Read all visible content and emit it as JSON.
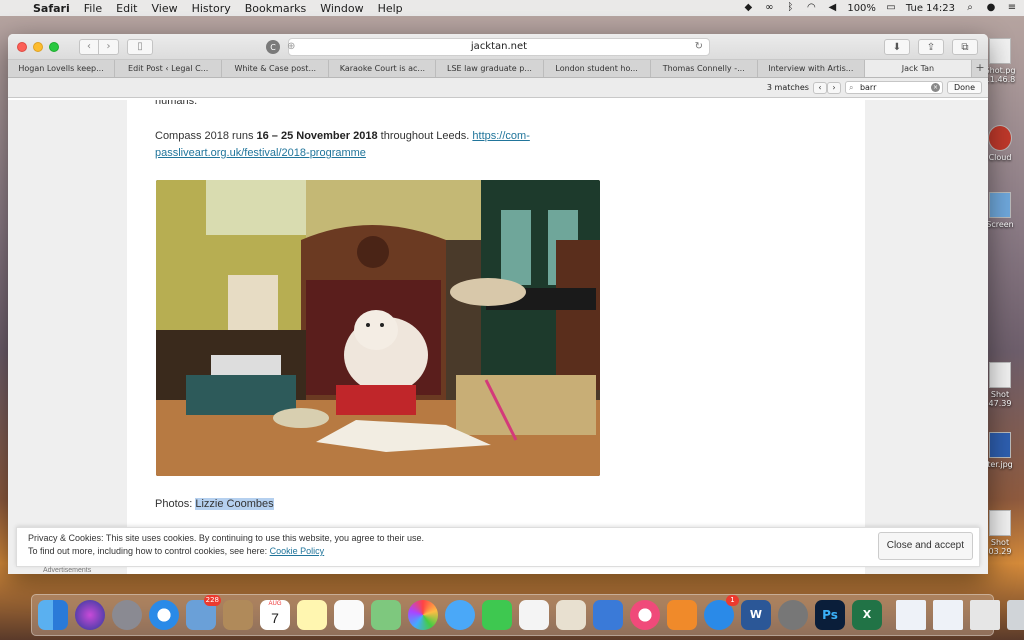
{
  "menubar": {
    "app": "Safari",
    "menus": [
      "File",
      "Edit",
      "View",
      "History",
      "Bookmarks",
      "Window",
      "Help"
    ],
    "battery": "100%",
    "clock": "Tue 14:23"
  },
  "desktop": {
    "items": [
      "Shot.pg",
      "11.46.8",
      "Cloud",
      "Screen",
      "Shot",
      "47.39",
      "ter.jpg",
      "Shot",
      "03.29"
    ]
  },
  "browser": {
    "url": "jacktan.net",
    "tabs": [
      "Hogan Lovells keep...",
      "Edit Post ‹ Legal C...",
      "White & Case post...",
      "Karaoke Court is ac...",
      "LSE law graduate p...",
      "London student ho...",
      "Thomas Connelly -...",
      "Interview with Artis...",
      "Jack Tan"
    ],
    "find": {
      "matches": "3 matches",
      "query": "barr",
      "done_label": "Done"
    }
  },
  "article": {
    "top_text": "humans.",
    "compass_prefix": "Compass 2018 runs ",
    "compass_dates": "16 – 25 November 2018",
    "compass_suffix": " throughout Leeds. ",
    "compass_link_1": "https://com-",
    "compass_link_2": "passliveart.org.uk/festival/2018-programme",
    "caption_prefix": "Photos: ",
    "caption_name": "Lizzie Coombes"
  },
  "cookie_banner": {
    "line1": "Privacy & Cookies: This site uses cookies. By continuing to use this website, you agree to their use.",
    "line2_prefix": "To find out more, including how to control cookies, see here: ",
    "policy_link": "Cookie Policy",
    "button": "Close and accept",
    "ads_label": "Advertisements"
  },
  "dock": {
    "calendar_month": "AUG",
    "calendar_day": "7",
    "mail_badge": "228",
    "appstore_badge": "1",
    "ps_label": "Ps",
    "word_label": "W",
    "excel_label": "X"
  }
}
